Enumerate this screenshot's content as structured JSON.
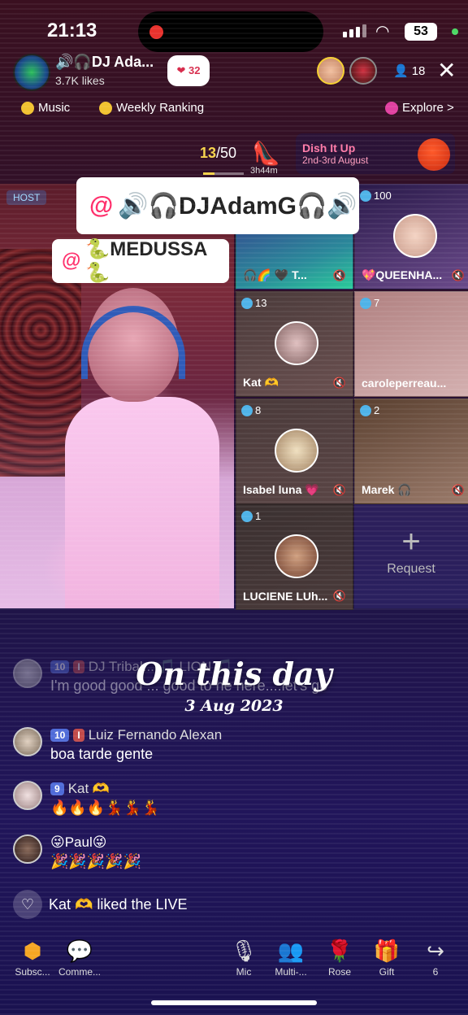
{
  "status": {
    "time": "21:13",
    "battery": "53"
  },
  "host": {
    "name": "🔊🎧DJ Ada...",
    "likes": "3.7K likes",
    "heart_badge": "32",
    "viewers": "18"
  },
  "chips": {
    "music": "Music",
    "weekly": "Weekly Ranking",
    "explore": "Explore >"
  },
  "ranking": {
    "current": "13",
    "total": "/50",
    "time": "3h44m"
  },
  "event": {
    "title": "Dish It Up",
    "subtitle": "2nd-3rd August"
  },
  "mentions": {
    "m1": "🔊🎧DJAdamG🎧🔊",
    "m2": "🐍MEDUSSA🐍",
    "at": "@"
  },
  "host_label": "HOST",
  "tiles": [
    {
      "badge": "",
      "name": "🎧🌈 🖤 T...",
      "colors": [
        "#3a2a8a",
        "#2acb9a"
      ]
    },
    {
      "badge": "100",
      "name": "💖QUEENHA...",
      "colors": [
        "#2a1a4a",
        "#6a4a8a"
      ]
    },
    {
      "badge": "13",
      "name": "Kat 🫶",
      "colors": [
        "#4a3a3a",
        "#6a5050"
      ]
    },
    {
      "badge": "7",
      "name": "caroleperreau...",
      "colors": [
        "#b08080",
        "#d4b0b0"
      ]
    },
    {
      "badge": "8",
      "name": "Isabel luna 💗",
      "colors": [
        "#4a3a3a",
        "#5a4545"
      ]
    },
    {
      "badge": "2",
      "name": "Marek 🎧",
      "colors": [
        "#5a4030",
        "#9a7a6a"
      ]
    },
    {
      "badge": "1",
      "name": "LUCIENE LUh...",
      "colors": [
        "#3a3030",
        "#4a3a3a"
      ]
    }
  ],
  "request": {
    "label": "Request",
    "plus": "+"
  },
  "on_this_day": {
    "title": "On this day",
    "date": "3 Aug 2023"
  },
  "comments": [
    {
      "lvl": "10",
      "lvl2": "I",
      "name": "DJ Tribal... 🎵 LION 🎵",
      "text": "I'm good good ... good to he here....let's go"
    },
    {
      "lvl": "10",
      "lvl2": "I",
      "name": "Luiz Fernando Alexan",
      "text": "boa tarde gente"
    },
    {
      "lvl": "9",
      "lvl2": "",
      "name": "Kat 🫶",
      "text": "🔥🔥🔥💃💃💃"
    },
    {
      "lvl": "",
      "lvl2": "",
      "name": "😜Paul😜",
      "text": "🎉🎉🎉🎉🎉"
    }
  ],
  "liked": {
    "text": "Kat 🫶 liked the LIVE"
  },
  "bottom": {
    "subscribe": "Subsc...",
    "comment": "Comme...",
    "mic": "Mic",
    "multi": "Multi-...",
    "rose": "Rose",
    "gift": "Gift",
    "share": "6"
  }
}
